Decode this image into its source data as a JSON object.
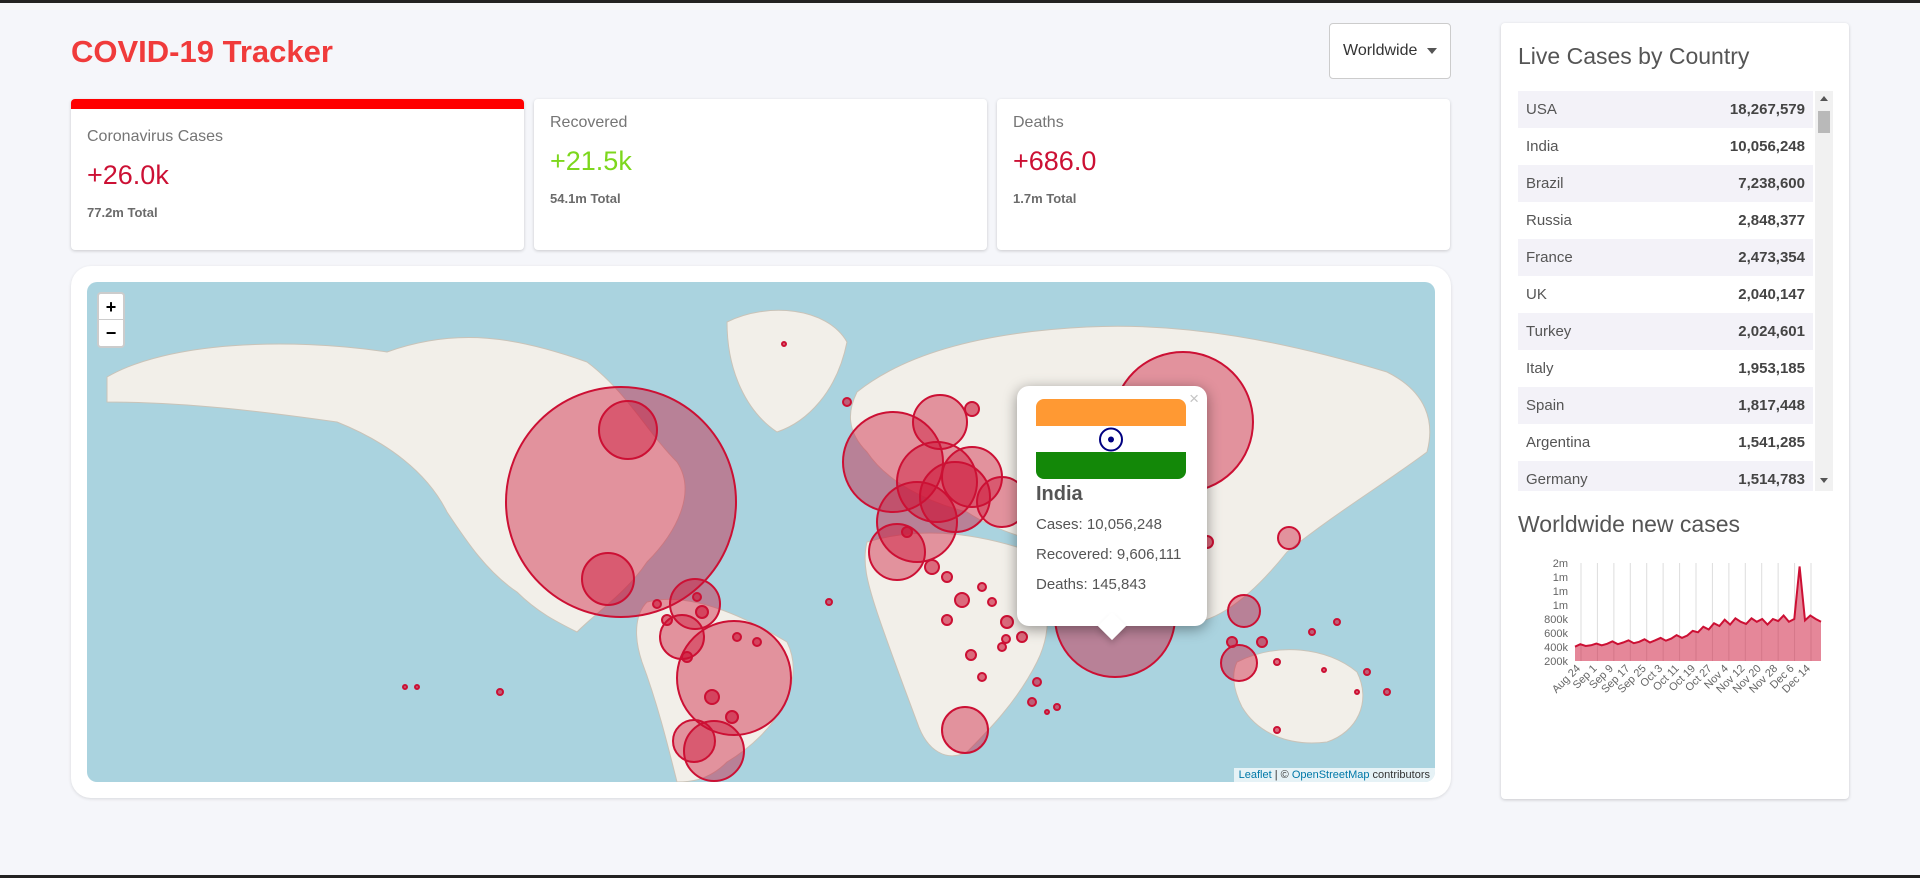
{
  "header": {
    "title": "COVID-19 Tracker",
    "dropdown": "Worldwide"
  },
  "cards": [
    {
      "label": "Coronavirus Cases",
      "value": "+26.0k",
      "total": "77.2m Total",
      "accent": "#ff0000"
    },
    {
      "label": "Recovered",
      "value": "+21.5k",
      "total": "54.1m Total",
      "accent": "#7dd71d"
    },
    {
      "label": "Deaths",
      "value": "+686.0",
      "total": "1.7m Total",
      "accent": "#cc1034"
    }
  ],
  "map": {
    "zoom_in": "+",
    "zoom_out": "−",
    "attribution": {
      "leaflet": "Leaflet",
      "sep": " | © ",
      "osm": "OpenStreetMap",
      "rest": " contributors"
    },
    "circle_color": "#cc1034",
    "popup": {
      "close": "×",
      "country": "India",
      "cases": "Cases: 10,056,248",
      "recovered": "Recovered: 9,606,111",
      "deaths": "Deaths: 145,843"
    }
  },
  "sidebar": {
    "table_title": "Live Cases by Country",
    "rows": [
      {
        "country": "USA",
        "cases": "18,267,579"
      },
      {
        "country": "India",
        "cases": "10,056,248"
      },
      {
        "country": "Brazil",
        "cases": "7,238,600"
      },
      {
        "country": "Russia",
        "cases": "2,848,377"
      },
      {
        "country": "France",
        "cases": "2,473,354"
      },
      {
        "country": "UK",
        "cases": "2,040,147"
      },
      {
        "country": "Turkey",
        "cases": "2,024,601"
      },
      {
        "country": "Italy",
        "cases": "1,953,185"
      },
      {
        "country": "Spain",
        "cases": "1,817,448"
      },
      {
        "country": "Argentina",
        "cases": "1,541,285"
      },
      {
        "country": "Germany",
        "cases": "1,514,783"
      }
    ],
    "chart_title": "Worldwide new cases"
  },
  "chart_data": {
    "type": "area",
    "title": "Worldwide new cases",
    "y_tick_labels": [
      "2m",
      "1m",
      "1m",
      "1m",
      "800k",
      "600k",
      "400k",
      "200k"
    ],
    "x_tick_labels": [
      "Aug 24",
      "Sep 1",
      "Sep 9",
      "Sep 17",
      "Sep 25",
      "Oct 3",
      "Oct 11",
      "Oct 19",
      "Oct 27",
      "Nov 4",
      "Nov 12",
      "Nov 20",
      "Nov 28",
      "Dec 6",
      "Dec 14"
    ],
    "ylim": [
      0,
      1400000
    ],
    "grid": "vertical",
    "color": "#cc1034",
    "series": [
      {
        "values": [
          205000,
          240000,
          215000,
          225000,
          250000,
          225000,
          245000,
          280000,
          240000,
          265000,
          295000,
          255000,
          275000,
          310000,
          265000,
          295000,
          330000,
          290000,
          320000,
          370000,
          330000,
          365000,
          430000,
          410000,
          490000,
          450000,
          540000,
          500000,
          590000,
          520000,
          610000,
          560000,
          530000,
          610000,
          560000,
          600000,
          520000,
          600000,
          570000,
          650000,
          560000,
          600000,
          1350000,
          580000,
          650000,
          600000,
          560000
        ]
      }
    ]
  }
}
